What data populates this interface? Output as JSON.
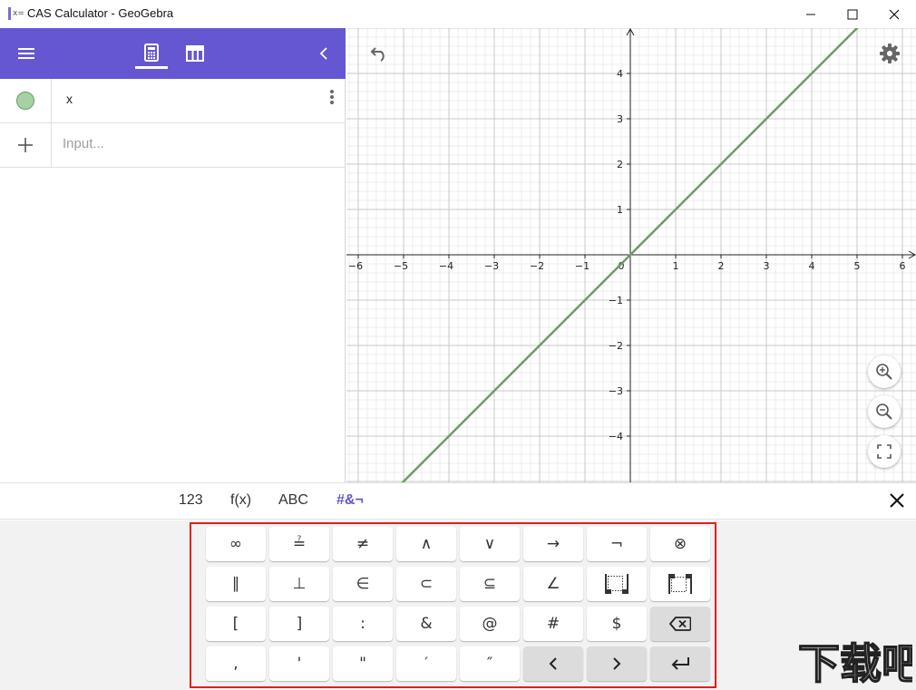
{
  "window": {
    "title": "CAS Calculator - GeoGebra",
    "app_icon_text": "x=",
    "controls": {
      "minimize": "—",
      "maximize": "☐",
      "close": "✕"
    }
  },
  "algebra": {
    "rows": [
      {
        "expression": "x",
        "marble_color": "#a6d2a3"
      }
    ],
    "input_placeholder": "Input..."
  },
  "graph": {
    "x_ticks": [
      "-6",
      "-5",
      "-4",
      "-3",
      "-2",
      "-1",
      "0",
      "1",
      "2",
      "3",
      "4",
      "5",
      "6"
    ],
    "y_ticks_pos": [
      "1",
      "2",
      "3",
      "4"
    ],
    "y_ticks_neg": [
      "-1",
      "-2",
      "-3",
      "-4"
    ],
    "line_color": "#6a9e63",
    "grid": true
  },
  "keyboard": {
    "tabs": [
      "123",
      "f(x)",
      "ABC",
      "#&¬"
    ],
    "active_tab": "#&¬",
    "rows": [
      [
        "∞",
        "≟",
        "≠",
        "∧",
        "∨",
        "→",
        "¬",
        "⊗"
      ],
      [
        "∥",
        "⊥",
        "∈",
        "⊂",
        "⊆",
        "∠",
        "",
        ""
      ],
      [
        "[",
        "]",
        ":",
        "&",
        "@",
        "#",
        "$",
        ""
      ],
      [
        ",",
        "'",
        "\"",
        "′",
        "″",
        "",
        "",
        ""
      ]
    ]
  },
  "colors": {
    "accent": "#6557d2",
    "highlight_frame": "#e0201c"
  },
  "watermark_text": "下载吧"
}
